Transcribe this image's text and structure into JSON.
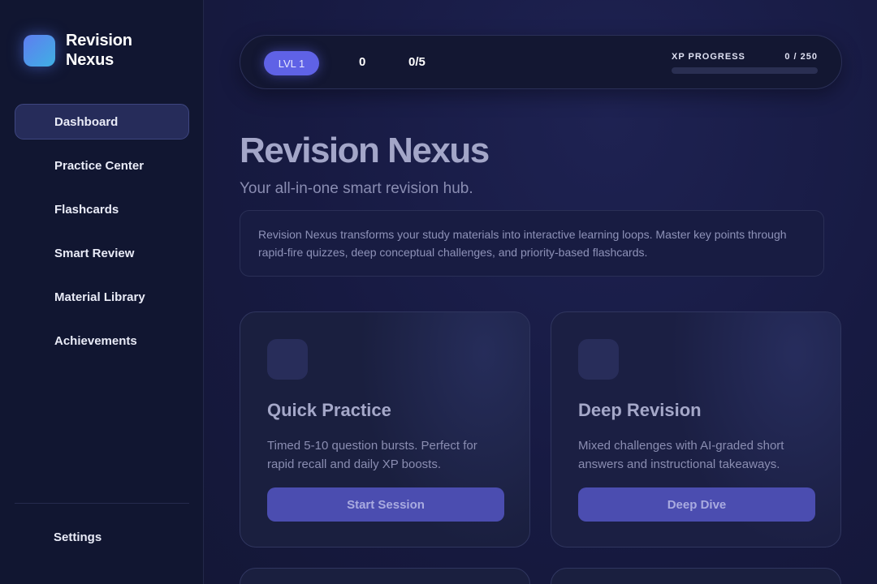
{
  "brand": {
    "name": "Revision Nexus",
    "logo_icon": "gradient-square-logo"
  },
  "sidebar": {
    "items": [
      {
        "label": "Dashboard",
        "active": true
      },
      {
        "label": "Practice Center",
        "active": false
      },
      {
        "label": "Flashcards",
        "active": false
      },
      {
        "label": "Smart Review",
        "active": false
      },
      {
        "label": "Material Library",
        "active": false
      },
      {
        "label": "Achievements",
        "active": false
      }
    ],
    "settings_label": "Settings"
  },
  "topbar": {
    "level": "LVL 1",
    "xp_value": "0",
    "goal_value": "0/5",
    "xp_label": "XP PROGRESS",
    "xp_count": "0 / 250",
    "xp_progress_fraction": 0
  },
  "hero": {
    "title": "Revision Nexus",
    "subtitle": "Your all-in-one smart revision hub.",
    "description": "Revision Nexus transforms your study materials into interactive learning loops. Master key points through rapid-fire quizzes, deep conceptual challenges, and priority-based flashcards."
  },
  "cards": [
    {
      "title": "Quick Practice",
      "description": "Timed 5-10 question bursts. Perfect for rapid recall and daily XP boosts.",
      "button_label": "Start Session"
    },
    {
      "title": "Deep Revision",
      "description": "Mixed challenges with AI-graded short answers and instructional takeaways.",
      "button_label": "Deep Dive"
    }
  ],
  "colors": {
    "accent": "#6366f1",
    "sidebar_bg": "#111631",
    "main_bg": "#171a42",
    "button_bg": "#4b4db0"
  }
}
